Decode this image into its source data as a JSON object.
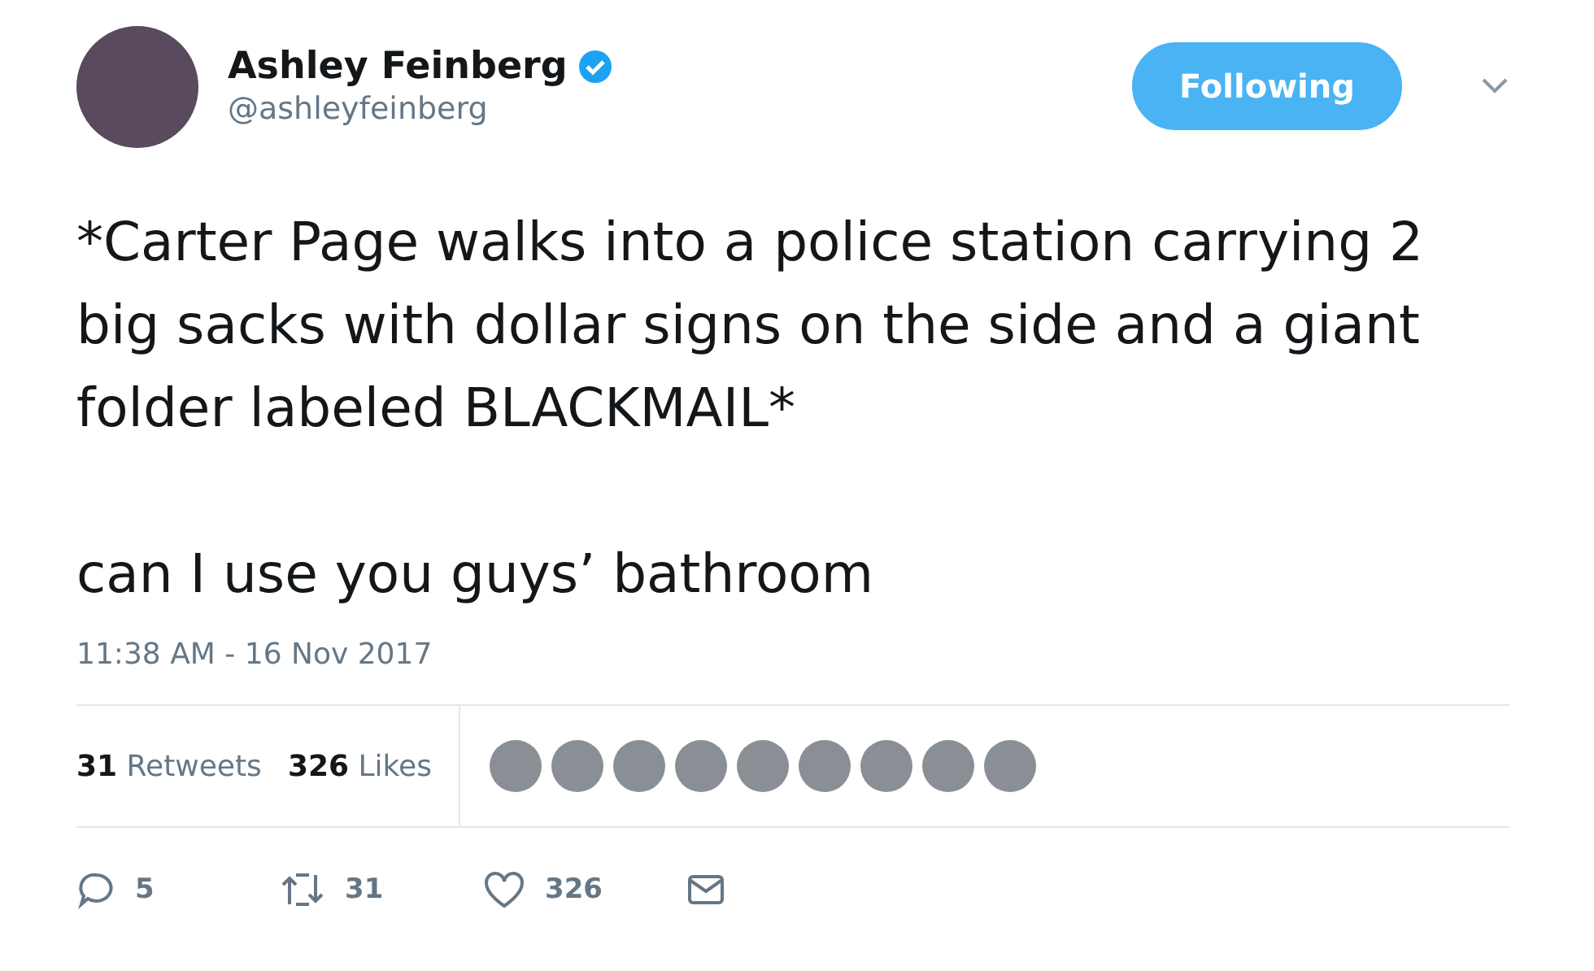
{
  "author": {
    "name": "Ashley Feinberg",
    "verified": true,
    "handle": "@ashleyfeinberg"
  },
  "follow_button": {
    "label": "Following",
    "selected": true
  },
  "tweet": {
    "lines": [
      "*Carter Page walks into a police station carrying 2 big sacks with dollar signs on the side and a giant folder labeled BLACKMAIL*",
      "can I use you guys’ bathroom"
    ],
    "timestamp": "11:38 AM - 16 Nov 2017"
  },
  "stats": [
    {
      "count": "31",
      "label": "Retweets"
    },
    {
      "count": "326",
      "label": "Likes"
    }
  ],
  "liked_by": [
    {
      "kind": "avatar"
    },
    {
      "kind": "avatar"
    },
    {
      "kind": "avatar"
    },
    {
      "kind": "avatar"
    },
    {
      "kind": "avatar"
    },
    {
      "kind": "avatar"
    },
    {
      "kind": "avatar"
    },
    {
      "kind": "avatar"
    },
    {
      "kind": "avatar"
    }
  ],
  "actions": [
    {
      "kind": "reply",
      "count": "5"
    },
    {
      "kind": "retweet",
      "count": "31"
    },
    {
      "kind": "like",
      "count": "326"
    },
    {
      "kind": "message"
    }
  ]
}
